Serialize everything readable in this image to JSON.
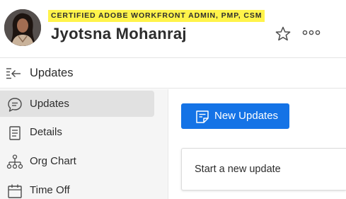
{
  "profile": {
    "subtitle": "CERTIFIED ADOBE WORKFRONT ADMIN, PMP, CSM",
    "name": "Jyotsna Mohanraj",
    "highlight_color": "#fff34a"
  },
  "header_actions": [
    {
      "icon": "star-icon"
    },
    {
      "icon": "more-icon"
    }
  ],
  "section": {
    "title": "Updates",
    "collapse_icon": "collapse-left-icon"
  },
  "nav": {
    "items": [
      {
        "label": "Updates",
        "icon": "chat-bubble-icon",
        "active": true
      },
      {
        "label": "Details",
        "icon": "document-icon",
        "active": false
      },
      {
        "label": "Org Chart",
        "icon": "org-chart-icon",
        "active": false
      },
      {
        "label": "Time Off",
        "icon": "calendar-icon",
        "active": false
      }
    ]
  },
  "main": {
    "new_updates_label": "New Updates",
    "new_updates_icon": "note-icon",
    "accent_color": "#1473e6",
    "compose_placeholder": "Start a new update"
  }
}
